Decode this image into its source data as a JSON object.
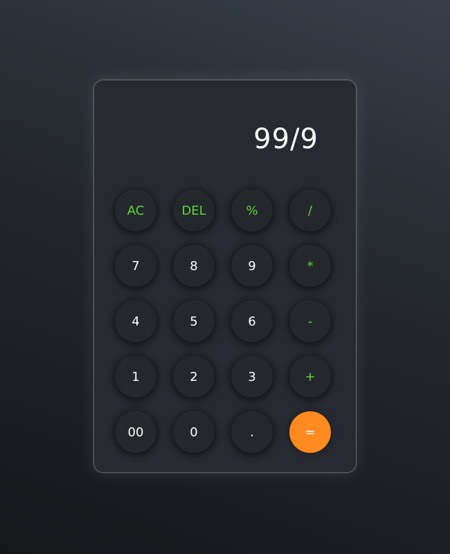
{
  "display": {
    "value": "99/9"
  },
  "keys": {
    "ac": "AC",
    "del": "DEL",
    "percent": "%",
    "divide": "/",
    "seven": "7",
    "eight": "8",
    "nine": "9",
    "multiply": "*",
    "four": "4",
    "five": "5",
    "six": "6",
    "subtract": "-",
    "one": "1",
    "two": "2",
    "three": "3",
    "add": "+",
    "double_zero": "00",
    "zero": "0",
    "decimal": ".",
    "equals": "="
  },
  "colors": {
    "operator": "#5fd63a",
    "equals_bg": "#ff8a1f",
    "digit": "#ffffff"
  }
}
